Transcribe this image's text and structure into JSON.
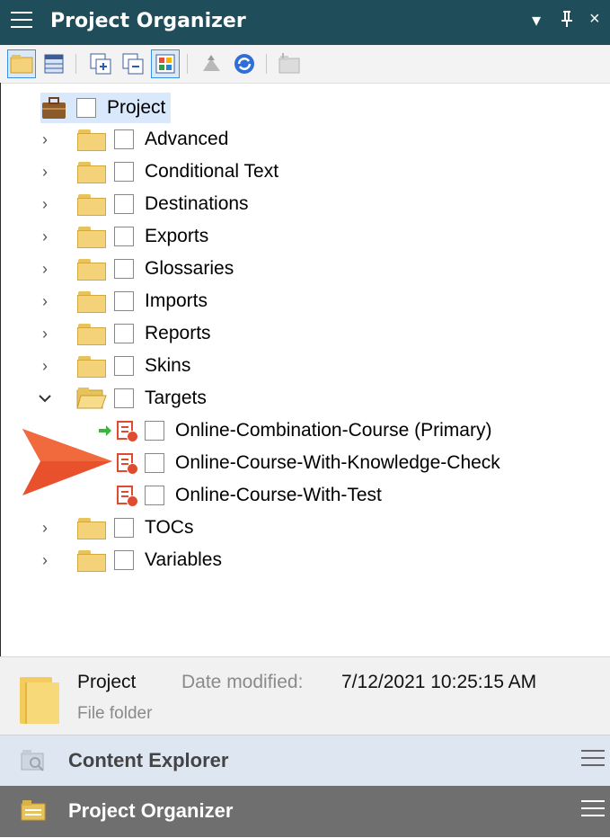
{
  "window": {
    "title": "Project Organizer",
    "controls": [
      "▾",
      "ᵽ",
      "×"
    ]
  },
  "toolbar": {
    "buttons": [
      "folder-view-icon",
      "table-view-icon",
      "expand-all-icon",
      "collapse-all-icon",
      "color-grid-icon",
      "build-icon",
      "refresh-icon",
      "new-item-icon"
    ]
  },
  "tree": {
    "root": "Project",
    "items": [
      {
        "label": "Advanced"
      },
      {
        "label": "Conditional Text"
      },
      {
        "label": "Destinations"
      },
      {
        "label": "Exports"
      },
      {
        "label": "Glossaries"
      },
      {
        "label": "Imports"
      },
      {
        "label": "Reports"
      },
      {
        "label": "Skins"
      },
      {
        "label": "Targets",
        "expanded": true
      },
      {
        "label": "Online-Combination-Course (Primary)",
        "child": true,
        "primary": true
      },
      {
        "label": "Online-Course-With-Knowledge-Check",
        "child": true,
        "highlighted_by_arrow": true
      },
      {
        "label": "Online-Course-With-Test",
        "child": true
      },
      {
        "label": "TOCs"
      },
      {
        "label": "Variables"
      }
    ]
  },
  "details": {
    "name": "Project",
    "date_modified_label": "Date modified:",
    "date_modified_value": "7/12/2021 10:25:15 AM",
    "type": "File folder"
  },
  "panels": [
    {
      "label": "Content Explorer",
      "active": false
    },
    {
      "label": "Project Organizer",
      "active": true
    }
  ],
  "colors": {
    "title_bar": "#1f4e5a",
    "pointer_arrow": "#e8512b",
    "target_icon": "#e04a2f",
    "primary_arrow": "#3bb53b",
    "panel_inactive": "#dde6f1",
    "panel_active": "#6f6f6f"
  }
}
